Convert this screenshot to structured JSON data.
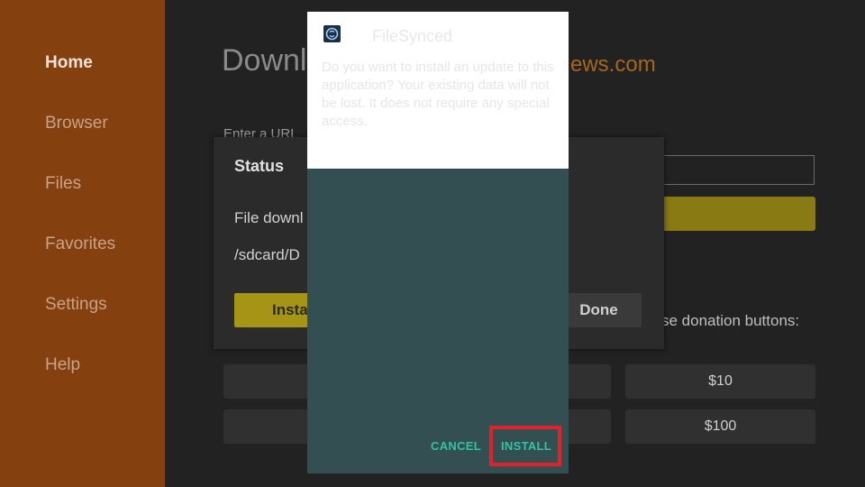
{
  "sidebar": {
    "items": [
      {
        "label": "Home",
        "active": true
      },
      {
        "label": "Browser"
      },
      {
        "label": "Files"
      },
      {
        "label": "Favorites"
      },
      {
        "label": "Settings"
      },
      {
        "label": "Help"
      }
    ]
  },
  "main": {
    "title": "Downl",
    "domain": "ews.com",
    "url_label": "Enter a URL",
    "donation_text": "se donation buttons:",
    "donations": [
      "$10",
      "$100"
    ]
  },
  "status_dialog": {
    "title": "Status",
    "line1": "File downl",
    "line2": "/sdcard/D",
    "install_label": "Insta",
    "done_label": "Done"
  },
  "install_dialog": {
    "app_name": "FileSynced",
    "message": "Do you want to install an update to this application? Your existing data will not be lost. It does not require any special access.",
    "cancel_label": "CANCEL",
    "install_label": "INSTALL"
  },
  "colors": {
    "sidebar_bg": "#84400f",
    "dialog_bg": "#344f51",
    "button_text": "#2ec4a4",
    "highlight": "#e1222c"
  }
}
